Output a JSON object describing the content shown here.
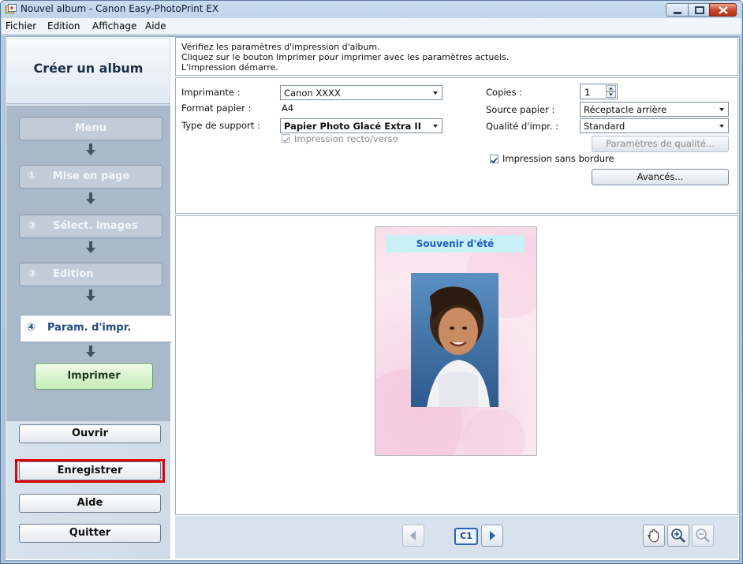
{
  "window": {
    "title": "Nouvel album - Canon Easy-PhotoPrint EX"
  },
  "menu": [
    "Fichier",
    "Edition",
    "Affichage",
    "Aide"
  ],
  "sidebar": {
    "title": "Créer un album",
    "steps": [
      {
        "label": "Menu"
      },
      {
        "num": "①",
        "label": "Mise en page"
      },
      {
        "num": "②",
        "label": "Sélect. images"
      },
      {
        "num": "③",
        "label": "Edition"
      }
    ],
    "active_step": {
      "num": "④",
      "label": "Param. d'impr."
    },
    "print_button": "Imprimer",
    "open_button": "Ouvrir",
    "save_button": "Enregistrer",
    "help_button": "Aide",
    "quit_button": "Quitter"
  },
  "info": {
    "line1": "Vérifiez les paramètres d'impression d'album.",
    "line2": "Cliquez sur le bouton Imprimer pour imprimer avec les paramètres actuels.",
    "line3": "L'impression démarre."
  },
  "settings": {
    "printer_label": "Imprimante :",
    "printer_value": "Canon XXXX",
    "paper_size_label": "Format papier :",
    "paper_size_value": "A4",
    "media_type_label": "Type de support :",
    "media_type_value": "Papier Photo Glacé Extra II",
    "duplex_label": "Impression recto/verso",
    "copies_label": "Copies :",
    "copies_value": "1",
    "paper_source_label": "Source papier :",
    "paper_source_value": "Réceptacle arrière",
    "quality_label": "Qualité d'impr. :",
    "quality_value": "Standard",
    "quality_settings_button": "Paramètres de qualité...",
    "borderless_label": "Impression sans bordure",
    "advanced_button": "Avancés..."
  },
  "preview": {
    "page_title": "Souvenir d'été",
    "page_indicator": "C1"
  }
}
